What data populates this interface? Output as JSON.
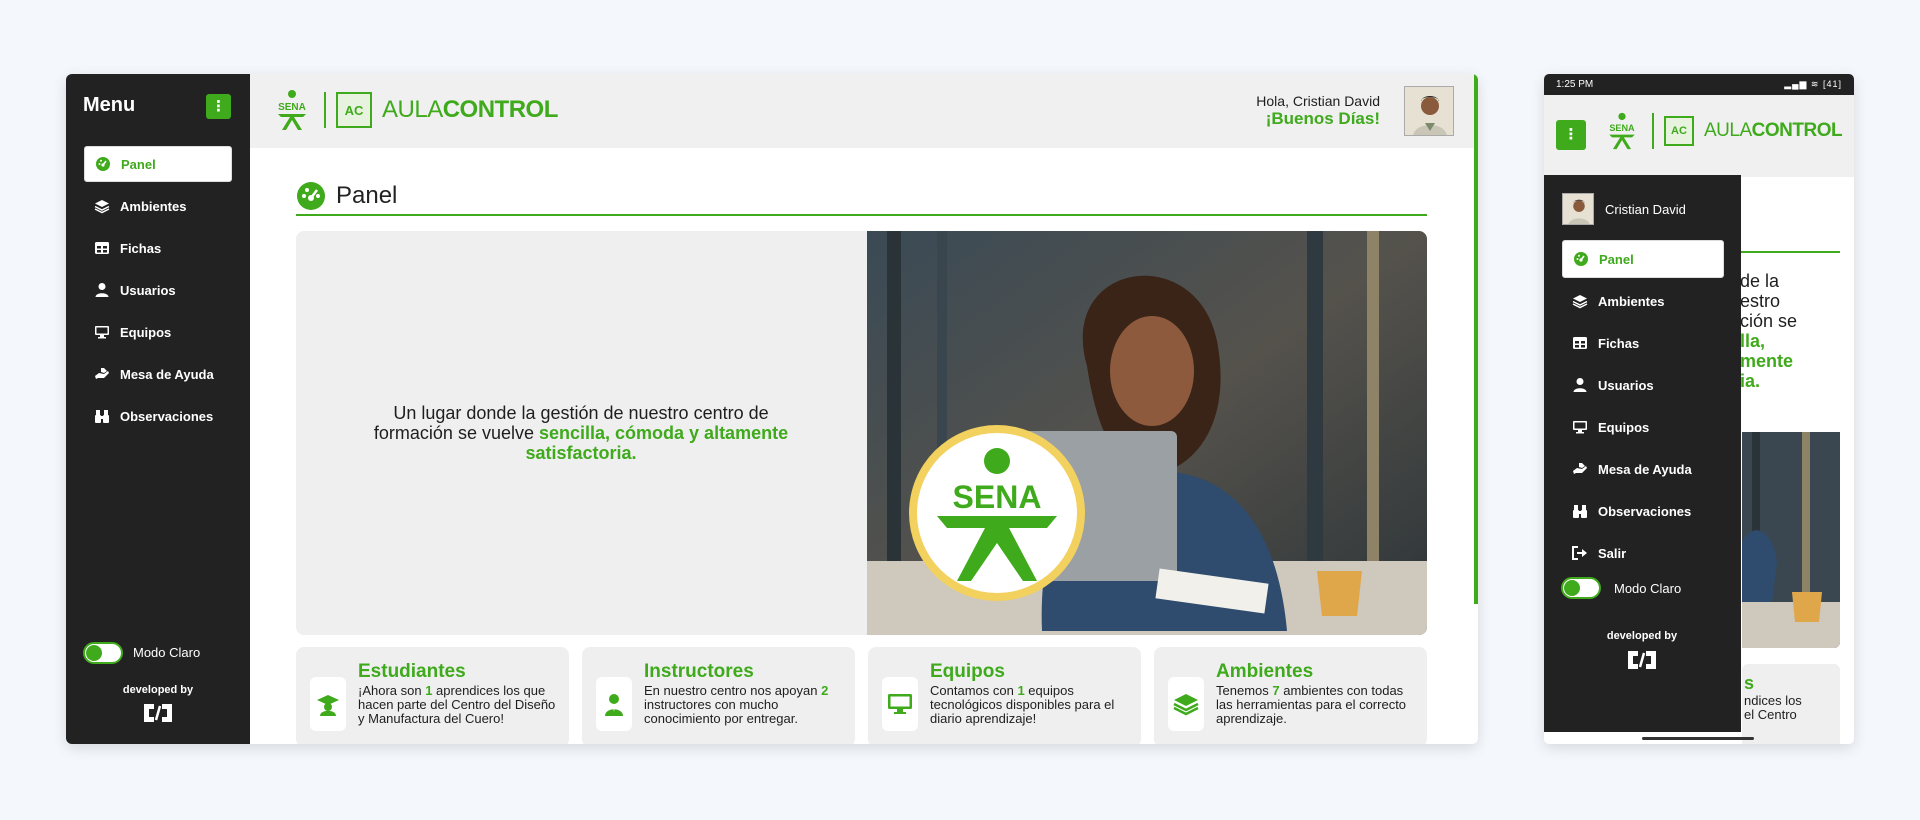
{
  "desktop": {
    "sidebar": {
      "title": "Menu",
      "items": [
        {
          "label": "Panel",
          "icon": "gauge-icon",
          "active": true
        },
        {
          "label": "Ambientes",
          "icon": "layers-icon",
          "active": false
        },
        {
          "label": "Fichas",
          "icon": "table-icon",
          "active": false
        },
        {
          "label": "Usuarios",
          "icon": "user-icon",
          "active": false
        },
        {
          "label": "Equipos",
          "icon": "monitor-icon",
          "active": false
        },
        {
          "label": "Mesa de Ayuda",
          "icon": "hands-help-icon",
          "active": false
        },
        {
          "label": "Observaciones",
          "icon": "binoculars-icon",
          "active": false
        }
      ],
      "mode_label": "Modo Claro",
      "developed_by": "developed by"
    },
    "header": {
      "brand_light": "AULA",
      "brand_bold": "CONTROL",
      "ac_badge": "AC",
      "greeting": "Hola, Cristian David",
      "salutation": "¡Buenos Días!"
    },
    "panel": {
      "title": "Panel",
      "hero_text_plain": "Un lugar donde la gestión de nuestro centro de formación se vuelve ",
      "hero_text_highlight": "sencilla, cómoda y altamente satisfactoria.",
      "hero_badge": "SENA"
    },
    "cards": [
      {
        "title": "Estudiantes",
        "pre": "¡Ahora son ",
        "num": "1",
        "post": " aprendices los que hacen parte del Centro del Diseño y Manufactura del Cuero!",
        "icon": "graduate-icon"
      },
      {
        "title": "Instructores",
        "pre": "En nuestro centro nos apoyan ",
        "num": "2",
        "post": " instructores con mucho conocimiento por entregar.",
        "icon": "instructor-icon"
      },
      {
        "title": "Equipos",
        "pre": "Contamos con ",
        "num": "1",
        "post": " equipos tecnológicos disponibles para el diario aprendizaje!",
        "icon": "monitor-icon"
      },
      {
        "title": "Ambientes",
        "pre": "Tenemos ",
        "num": "7",
        "post": " ambientes con todas las herramientas para el correcto aprendizaje.",
        "icon": "layers-icon"
      }
    ]
  },
  "mobile": {
    "status_time": "1:25 PM",
    "status_battery": "41",
    "user_name": "Cristian David",
    "drawer_items": [
      {
        "label": "Panel",
        "icon": "gauge-icon",
        "active": true
      },
      {
        "label": "Ambientes",
        "icon": "layers-icon",
        "active": false
      },
      {
        "label": "Fichas",
        "icon": "table-icon",
        "active": false
      },
      {
        "label": "Usuarios",
        "icon": "user-icon",
        "active": false
      },
      {
        "label": "Equipos",
        "icon": "monitor-icon",
        "active": false
      },
      {
        "label": "Mesa de Ayuda",
        "icon": "hands-help-icon",
        "active": false
      },
      {
        "label": "Observaciones",
        "icon": "binoculars-icon",
        "active": false
      },
      {
        "label": "Salir",
        "icon": "logout-icon",
        "active": false
      }
    ],
    "mode_label": "Modo Claro",
    "developed_by": "developed by",
    "behind_text_1": "de la",
    "behind_text_2": "estro",
    "behind_text_3": "ción se",
    "behind_text_4": "lla,",
    "behind_text_5": "mente",
    "behind_text_6": "ia.",
    "behind_head_char": "l",
    "behind_card_1": "s",
    "behind_card_2": "ndices los",
    "behind_card_3": "el Centro"
  },
  "colors": {
    "accent": "#3faa1c",
    "sidebar": "#222222",
    "surface": "#efefef"
  }
}
